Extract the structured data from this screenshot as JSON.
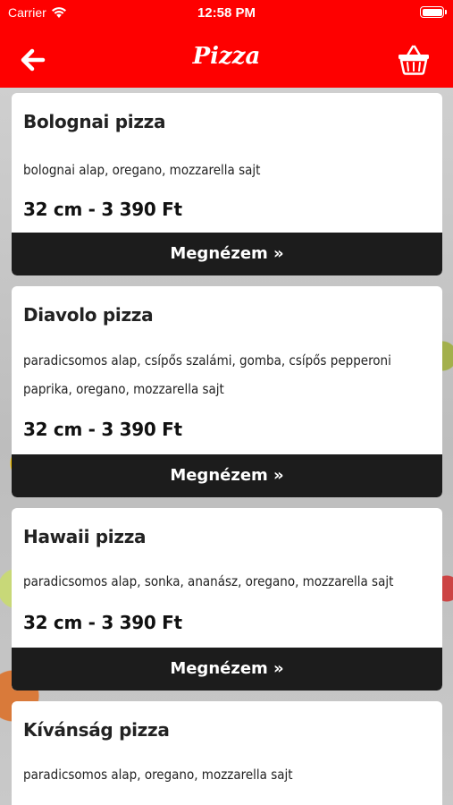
{
  "status_bar": {
    "carrier": "Carrier",
    "time": "12:58 PM"
  },
  "nav": {
    "title": "Pizza",
    "back_icon": "arrow-left-icon",
    "cart_icon": "basket-icon"
  },
  "colors": {
    "header": "#fe0000",
    "button": "#1c1c1c"
  },
  "products": [
    {
      "name": "Bolognai pizza",
      "description": "bolognai alap, oregano, mozzarella sajt",
      "price": "32 cm - 3 390 Ft",
      "button_label": "Megnézem »"
    },
    {
      "name": "Diavolo pizza",
      "description": "paradicsomos alap, csípős szalámi, gomba, csípős pepperoni paprika, oregano, mozzarella sajt",
      "price": "32 cm - 3 390 Ft",
      "button_label": "Megnézem »"
    },
    {
      "name": "Hawaii pizza",
      "description": "paradicsomos alap, sonka, ananász, oregano, mozzarella sajt",
      "price": "32 cm - 3 390 Ft",
      "button_label": "Megnézem »"
    },
    {
      "name": "Kívánság pizza",
      "description": "paradicsomos alap, oregano, mozzarella sajt",
      "price": "",
      "button_label": ""
    }
  ]
}
